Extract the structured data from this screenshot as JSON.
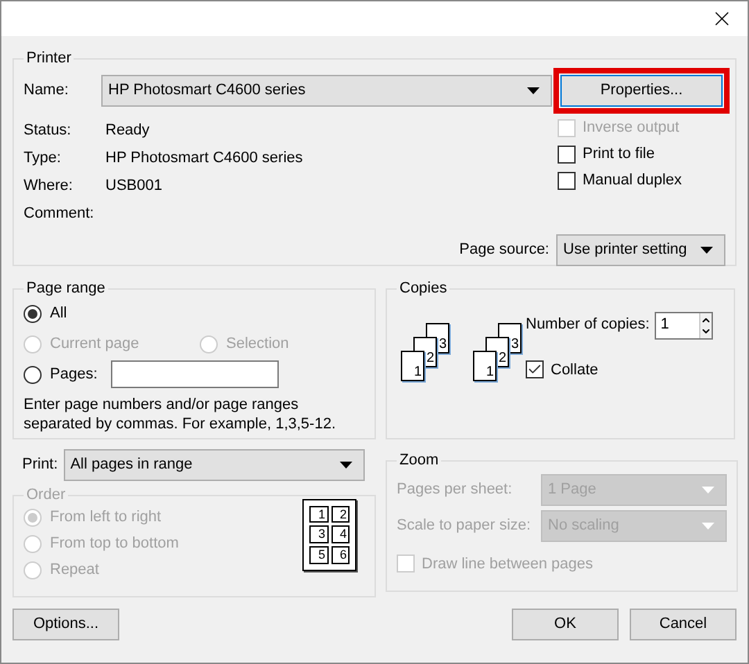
{
  "printer": {
    "title": "Printer",
    "name_label": "Name:",
    "name_value": "HP Photosmart C4600 series",
    "properties_button": {
      "label": "Properties...",
      "highlighted": true
    },
    "info": [
      {
        "label": "Status:",
        "value": "Ready"
      },
      {
        "label": "Type:",
        "value": "HP Photosmart C4600 series"
      },
      {
        "label": "Where:",
        "value": "USB001"
      },
      {
        "label": "Comment:"
      }
    ],
    "options": [
      {
        "label": "Inverse output",
        "checked": false,
        "disabled": true
      },
      {
        "label": "Print to file",
        "checked": false,
        "disabled": false
      },
      {
        "label": "Manual duplex",
        "checked": false,
        "disabled": false
      }
    ],
    "page_source": {
      "label": "Page source:",
      "value": "Use printer setting"
    }
  },
  "page_range": {
    "title": "Page range",
    "options": [
      {
        "label": "All",
        "selected": true,
        "disabled": false
      },
      {
        "label": "Current page",
        "selected": false,
        "disabled": true
      },
      {
        "label": "Selection",
        "selected": false,
        "disabled": true
      },
      {
        "label": "Pages:",
        "selected": false,
        "disabled": false
      }
    ],
    "hint": "Enter page numbers and/or page ranges separated by commas. For example, 1,3,5-12."
  },
  "print": {
    "label": "Print:",
    "value": "All pages in range"
  },
  "order": {
    "title": "Order",
    "disabled": true,
    "options": [
      {
        "label": "From left to right",
        "selected": true
      },
      {
        "label": "From top to bottom",
        "selected": false
      },
      {
        "label": "Repeat",
        "selected": false
      }
    ],
    "preview_pages": [
      "1",
      "2",
      "3",
      "4",
      "5",
      "6"
    ]
  },
  "copies": {
    "title": "Copies",
    "stacks": [
      {
        "pages": [
          "1",
          "2",
          "3"
        ]
      },
      {
        "pages": [
          "1",
          "2",
          "3"
        ]
      }
    ],
    "number_label": "Number of copies:",
    "number_value": "1",
    "collate": {
      "label": "Collate",
      "checked": true
    }
  },
  "zoom": {
    "title": "Zoom",
    "disabled": true,
    "fields": [
      {
        "label": "Pages per sheet:",
        "value": "1 Page"
      },
      {
        "label": "Scale to paper size:",
        "value": "No scaling"
      }
    ],
    "draw_lines": {
      "label": "Draw line between pages",
      "checked": false
    }
  },
  "buttons": [
    {
      "label": "Options..."
    },
    {
      "label": "OK"
    },
    {
      "label": "Cancel"
    }
  ]
}
